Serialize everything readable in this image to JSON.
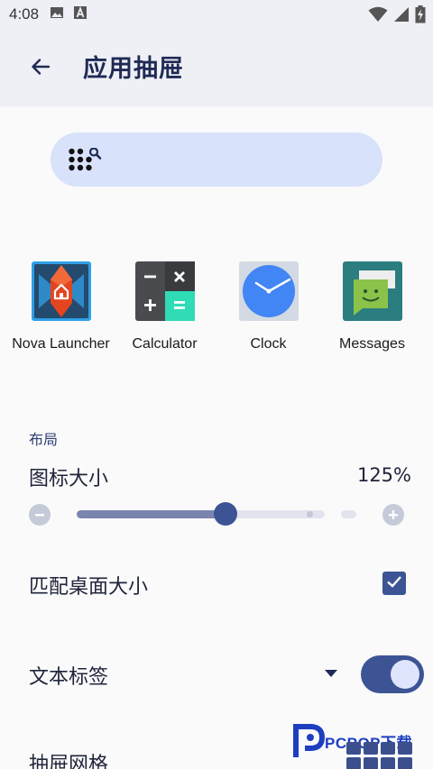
{
  "statusbar": {
    "time": "4:08",
    "left_icons": [
      "image-icon",
      "a-notification-icon"
    ],
    "right_icons": [
      "wifi-icon",
      "cell-signal-icon",
      "battery-charging-icon"
    ]
  },
  "appbar": {
    "title": "应用抽屉",
    "back_icon": "arrow-left-icon"
  },
  "search": {
    "icon": "search-dots-icon"
  },
  "apps": [
    {
      "label": "Nova Launcher",
      "icon": "nova-launcher-icon"
    },
    {
      "label": "Calculator",
      "icon": "calculator-icon"
    },
    {
      "label": "Clock",
      "icon": "clock-icon"
    },
    {
      "label": "Messages",
      "icon": "messages-icon"
    }
  ],
  "layout_section": {
    "label": "布局",
    "icon_size": {
      "title": "图标大小",
      "value_text": "125%",
      "value": 125
    },
    "match_desktop_size": {
      "title": "匹配桌面大小",
      "checked": true
    },
    "text_labels": {
      "title": "文本标签",
      "enabled": true
    },
    "drawer_grid": {
      "title": "抽屉网格"
    }
  },
  "watermark": {
    "text": "PCPOP下载",
    "sub_text": "PCPOP"
  },
  "colors": {
    "accent": "#3d5494",
    "appbar_bg": "#eff0f5",
    "search_bg": "#d9e2fb",
    "title_text": "#1f2a55"
  }
}
